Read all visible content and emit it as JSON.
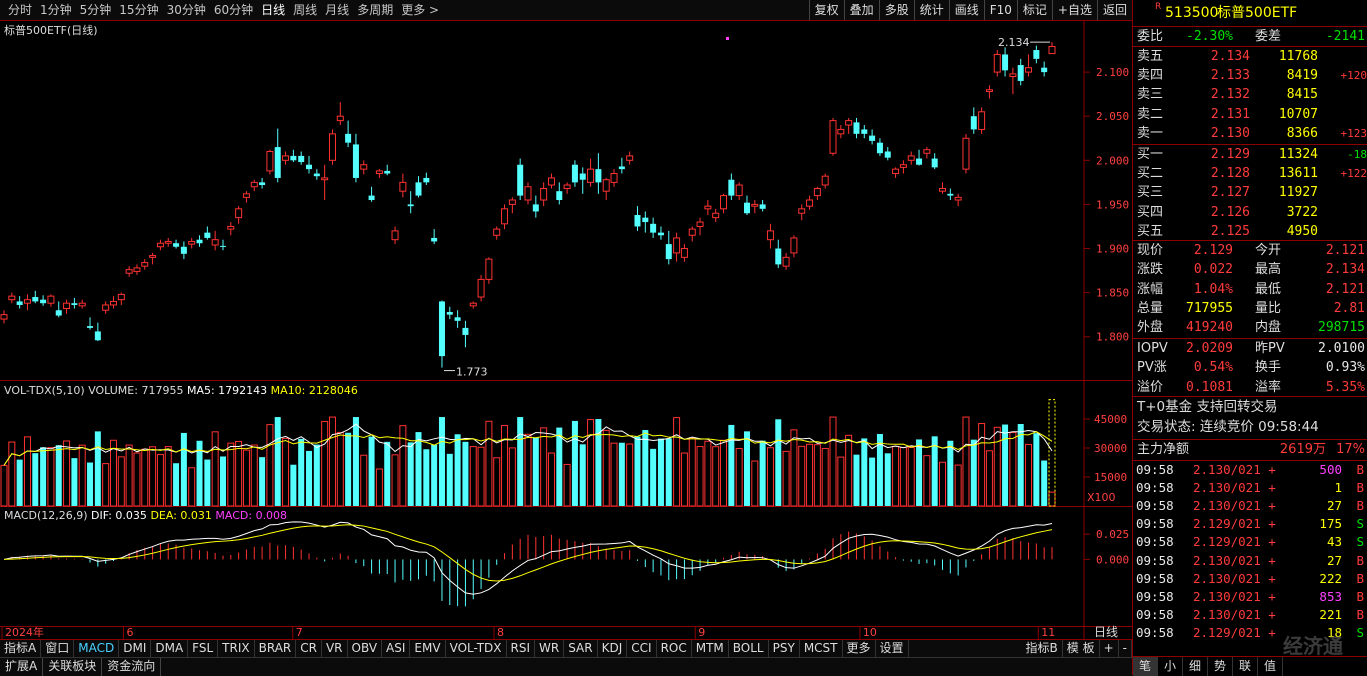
{
  "periods": [
    "分时",
    "1分钟",
    "5分钟",
    "15分钟",
    "30分钟",
    "60分钟",
    "日线",
    "周线",
    "月线",
    "多周期",
    "更多 >"
  ],
  "active_period": "日线",
  "tools": [
    "复权",
    "叠加",
    "多股",
    "统计",
    "画线",
    "F10",
    "标记",
    "+自选",
    "返回"
  ],
  "chart_title": "标普500ETF(日线)",
  "price_axis": [
    "2.100",
    "2.050",
    "2.000",
    "1.950",
    "1.900",
    "1.850",
    "1.800"
  ],
  "high_label": "2.134",
  "low_label": "1.773",
  "vol_title": {
    "name": "VOL-TDX(5,10)",
    "volume": "VOLUME: 717955",
    "ma5": "MA5: 1792143",
    "ma10": "MA10: 2128046"
  },
  "vol_axis": [
    "45000",
    "30000",
    "15000"
  ],
  "vol_unit": "X100",
  "macd_title": {
    "name": "MACD(12,26,9)",
    "dif": "DIF: 0.035",
    "dea": "DEA: 0.031",
    "macd": "MACD: 0.008"
  },
  "macd_axis": [
    "0.025",
    "0.000"
  ],
  "date_axis": [
    "2024年",
    "6",
    "7",
    "8",
    "9",
    "10",
    "11"
  ],
  "date_right": "日线",
  "indicator_tabs": [
    "指标A",
    "窗口",
    "MACD",
    "DMI",
    "DMA",
    "FSL",
    "TRIX",
    "BRAR",
    "CR",
    "VR",
    "OBV",
    "ASI",
    "EMV",
    "VOL-TDX",
    "RSI",
    "WR",
    "SAR",
    "KDJ",
    "CCI",
    "ROC",
    "MTM",
    "BOLL",
    "PSY",
    "MCST",
    "更多",
    "设置"
  ],
  "active_indicator": "MACD",
  "indicator_right": [
    "指标B",
    "模 板",
    "+",
    "-"
  ],
  "bottom_tabs": [
    "扩展A",
    "关联板块",
    "资金流向"
  ],
  "panel": {
    "marker": "R",
    "code": "513500",
    "name": "标普500ETF",
    "weibi_label": "委比",
    "weibi": "-2.30%",
    "weicha_label": "委差",
    "weicha": "-2141",
    "asks": [
      {
        "label": "卖五",
        "price": "2.134",
        "vol": "11768",
        "chg": ""
      },
      {
        "label": "卖四",
        "price": "2.133",
        "vol": "8419",
        "chg": "+120"
      },
      {
        "label": "卖三",
        "price": "2.132",
        "vol": "8415",
        "chg": ""
      },
      {
        "label": "卖二",
        "price": "2.131",
        "vol": "10707",
        "chg": ""
      },
      {
        "label": "卖一",
        "price": "2.130",
        "vol": "8366",
        "chg": "+123"
      }
    ],
    "bids": [
      {
        "label": "买一",
        "price": "2.129",
        "vol": "11324",
        "chg": "-18"
      },
      {
        "label": "买二",
        "price": "2.128",
        "vol": "13611",
        "chg": "+122"
      },
      {
        "label": "买三",
        "price": "2.127",
        "vol": "11927",
        "chg": ""
      },
      {
        "label": "买四",
        "price": "2.126",
        "vol": "3722",
        "chg": ""
      },
      {
        "label": "买五",
        "price": "2.125",
        "vol": "4950",
        "chg": ""
      }
    ],
    "quote": [
      {
        "l1": "现价",
        "v1": "2.129",
        "c1": "red",
        "l2": "今开",
        "v2": "2.121",
        "c2": "red"
      },
      {
        "l1": "涨跌",
        "v1": "0.022",
        "c1": "red",
        "l2": "最高",
        "v2": "2.134",
        "c2": "red"
      },
      {
        "l1": "涨幅",
        "v1": "1.04%",
        "c1": "red",
        "l2": "最低",
        "v2": "2.121",
        "c2": "red"
      },
      {
        "l1": "总量",
        "v1": "717955",
        "c1": "yellow",
        "l2": "量比",
        "v2": "2.81",
        "c2": "red"
      },
      {
        "l1": "外盘",
        "v1": "419240",
        "c1": "red",
        "l2": "内盘",
        "v2": "298715",
        "c2": "green"
      }
    ],
    "iopv": [
      {
        "l1": "IOPV",
        "v1": "2.0209",
        "c1": "red",
        "l2": "昨PV",
        "v2": "2.0100",
        "c2": "white"
      },
      {
        "l1": "PV涨",
        "v1": "0.54%",
        "c1": "red",
        "l2": "换手",
        "v2": "0.93%",
        "c2": "white"
      },
      {
        "l1": "溢价",
        "v1": "0.1081",
        "c1": "red",
        "l2": "溢率",
        "v2": "5.35%",
        "c2": "red"
      }
    ],
    "t0": "T+0基金 支持回转交易",
    "trade_status": "交易状态: 连续竞价 09:58:44",
    "mainflow_label": "主力净额",
    "mainflow": "2619万",
    "mainflow_pct": "17%",
    "ticks": [
      {
        "t": "09:58",
        "p": "2.130/021 +",
        "v": "500",
        "vc": "mag",
        "s": "B"
      },
      {
        "t": "09:58",
        "p": "2.130/021 +",
        "v": "1",
        "vc": "yellow",
        "s": "B"
      },
      {
        "t": "09:58",
        "p": "2.130/021 +",
        "v": "27",
        "vc": "yellow",
        "s": "B"
      },
      {
        "t": "09:58",
        "p": "2.129/021 +",
        "v": "175",
        "vc": "yellow",
        "s": "S"
      },
      {
        "t": "09:58",
        "p": "2.129/021 +",
        "v": "43",
        "vc": "yellow",
        "s": "S"
      },
      {
        "t": "09:58",
        "p": "2.130/021 +",
        "v": "27",
        "vc": "yellow",
        "s": "B"
      },
      {
        "t": "09:58",
        "p": "2.130/021 +",
        "v": "222",
        "vc": "yellow",
        "s": "B"
      },
      {
        "t": "09:58",
        "p": "2.130/021 +",
        "v": "853",
        "vc": "mag",
        "s": "B"
      },
      {
        "t": "09:58",
        "p": "2.130/021 +",
        "v": "221",
        "vc": "yellow",
        "s": "B"
      },
      {
        "t": "09:58",
        "p": "2.129/021 +",
        "v": "18",
        "vc": "yellow",
        "s": "S"
      }
    ],
    "bottom_tabs": [
      "笔",
      "小",
      "细",
      "势",
      "联",
      "值"
    ]
  },
  "watermark": "经济通",
  "chart_data": {
    "type": "candlestick",
    "y_range": [
      1.76,
      2.15
    ],
    "candles": [
      [
        1.82,
        1.83,
        1.815,
        1.825
      ],
      [
        1.842,
        1.85,
        1.838,
        1.846
      ],
      [
        1.84,
        1.846,
        1.832,
        1.836
      ],
      [
        1.838,
        1.848,
        1.83,
        1.842
      ],
      [
        1.845,
        1.852,
        1.838,
        1.84
      ],
      [
        1.842,
        1.847,
        1.835,
        1.838
      ],
      [
        1.838,
        1.848,
        1.834,
        1.846
      ],
      [
        1.83,
        1.84,
        1.822,
        1.824
      ],
      [
        1.832,
        1.842,
        1.826,
        1.838
      ],
      [
        1.838,
        1.844,
        1.832,
        1.836
      ],
      [
        1.835,
        1.842,
        1.832,
        1.838
      ],
      [
        1.812,
        1.822,
        1.808,
        1.81
      ],
      [
        1.806,
        1.816,
        1.795,
        1.796
      ],
      [
        1.83,
        1.84,
        1.826,
        1.836
      ],
      [
        1.836,
        1.846,
        1.832,
        1.84
      ],
      [
        1.842,
        1.85,
        1.836,
        1.848
      ],
      [
        1.872,
        1.88,
        1.868,
        1.876
      ],
      [
        1.874,
        1.882,
        1.87,
        1.878
      ],
      [
        1.88,
        1.888,
        1.876,
        1.884
      ],
      [
        1.89,
        1.895,
        1.882,
        1.892
      ],
      [
        1.902,
        1.91,
        1.898,
        1.906
      ],
      [
        1.906,
        1.912,
        1.902,
        1.908
      ],
      [
        1.906,
        1.91,
        1.9,
        1.902
      ],
      [
        1.902,
        1.908,
        1.888,
        1.894
      ],
      [
        1.905,
        1.912,
        1.9,
        1.908
      ],
      [
        1.91,
        1.915,
        1.902,
        1.906
      ],
      [
        1.918,
        1.925,
        1.91,
        1.912
      ],
      [
        1.904,
        1.92,
        1.898,
        1.91
      ],
      [
        1.903,
        1.91,
        1.898,
        1.902
      ],
      [
        1.922,
        1.93,
        1.915,
        1.925
      ],
      [
        1.935,
        1.948,
        1.928,
        1.945
      ],
      [
        1.958,
        1.965,
        1.952,
        1.962
      ],
      [
        1.97,
        1.978,
        1.965,
        1.975
      ],
      [
        1.975,
        1.98,
        1.968,
        1.972
      ],
      [
        1.988,
        2.012,
        1.984,
        2.01
      ],
      [
        2.015,
        2.036,
        1.975,
        1.98
      ],
      [
        2.0,
        2.01,
        1.995,
        2.005
      ],
      [
        2.005,
        2.012,
        1.998,
        2.0
      ],
      [
        2.005,
        2.01,
        1.995,
        1.998
      ],
      [
        1.995,
        2.005,
        1.985,
        1.99
      ],
      [
        1.985,
        1.99,
        1.978,
        1.982
      ],
      [
        1.978,
        1.995,
        1.955,
        1.98
      ],
      [
        2.0,
        2.035,
        1.995,
        2.03
      ],
      [
        2.045,
        2.066,
        2.04,
        2.05
      ],
      [
        2.03,
        2.045,
        2.015,
        2.02
      ],
      [
        2.018,
        2.03,
        1.975,
        1.98
      ],
      [
        1.99,
        2.0,
        1.984,
        1.995
      ],
      [
        1.96,
        1.97,
        1.953,
        1.955
      ],
      [
        1.985,
        1.99,
        1.98,
        1.988
      ],
      [
        1.988,
        1.995,
        1.983,
        1.985
      ],
      [
        1.91,
        1.925,
        1.905,
        1.92
      ],
      [
        1.965,
        1.985,
        1.958,
        1.975
      ],
      [
        1.95,
        1.965,
        1.94,
        1.948
      ],
      [
        1.975,
        1.982,
        1.958,
        1.96
      ],
      [
        1.98,
        1.986,
        1.972,
        1.975
      ],
      [
        1.912,
        1.922,
        1.905,
        1.908
      ],
      [
        1.84,
        1.841,
        1.765,
        1.778
      ],
      [
        1.828,
        1.834,
        1.82,
        1.825
      ],
      [
        1.822,
        1.83,
        1.81,
        1.818
      ],
      [
        1.81,
        1.818,
        1.788,
        1.802
      ],
      [
        1.835,
        1.84,
        1.832,
        1.838
      ],
      [
        1.845,
        1.87,
        1.84,
        1.865
      ],
      [
        1.865,
        1.89,
        1.86,
        1.888
      ],
      [
        1.915,
        1.925,
        1.91,
        1.922
      ],
      [
        1.928,
        1.95,
        1.922,
        1.945
      ],
      [
        1.95,
        1.958,
        1.94,
        1.955
      ],
      [
        1.995,
        2.002,
        1.955,
        1.96
      ],
      [
        1.955,
        1.975,
        1.95,
        1.97
      ],
      [
        1.95,
        1.96,
        1.935,
        1.942
      ],
      [
        1.955,
        1.975,
        1.948,
        1.968
      ],
      [
        1.972,
        1.985,
        1.968,
        1.98
      ],
      [
        1.965,
        1.975,
        1.95,
        1.955
      ],
      [
        1.968,
        1.975,
        1.962,
        1.972
      ],
      [
        1.995,
        2.0,
        1.97,
        1.975
      ],
      [
        1.985,
        1.992,
        1.962,
        1.978
      ],
      [
        1.975,
        2.002,
        1.97,
        1.99
      ],
      [
        1.99,
        2.008,
        1.962,
        1.975
      ],
      [
        1.965,
        1.98,
        1.955,
        1.978
      ],
      [
        1.975,
        1.99,
        1.97,
        1.985
      ],
      [
        1.993,
        2.003,
        1.985,
        1.99
      ],
      [
        2.0,
        2.01,
        1.995,
        2.005
      ],
      [
        1.938,
        1.948,
        1.92,
        1.925
      ],
      [
        1.935,
        1.942,
        1.918,
        1.93
      ],
      [
        1.928,
        1.935,
        1.912,
        1.918
      ],
      [
        1.918,
        1.925,
        1.91,
        1.915
      ],
      [
        1.905,
        1.92,
        1.882,
        1.888
      ],
      [
        1.895,
        1.918,
        1.885,
        1.912
      ],
      [
        1.89,
        1.905,
        1.885,
        1.9
      ],
      [
        1.915,
        1.925,
        1.908,
        1.922
      ],
      [
        1.925,
        1.935,
        1.915,
        1.93
      ],
      [
        1.945,
        1.955,
        1.938,
        1.948
      ],
      [
        1.935,
        1.945,
        1.93,
        1.94
      ],
      [
        1.945,
        1.962,
        1.94,
        1.96
      ],
      [
        1.978,
        1.985,
        1.955,
        1.96
      ],
      [
        1.96,
        1.975,
        1.955,
        1.972
      ],
      [
        1.952,
        1.96,
        1.938,
        1.94
      ],
      [
        1.948,
        1.955,
        1.94,
        1.95
      ],
      [
        1.95,
        1.955,
        1.942,
        1.945
      ],
      [
        1.91,
        1.928,
        1.9,
        1.92
      ],
      [
        1.9,
        1.91,
        1.878,
        1.882
      ],
      [
        1.88,
        1.895,
        1.876,
        1.89
      ],
      [
        1.895,
        1.915,
        1.89,
        1.912
      ],
      [
        1.94,
        1.95,
        1.932,
        1.945
      ],
      [
        1.948,
        1.96,
        1.944,
        1.955
      ],
      [
        1.96,
        1.97,
        1.955,
        1.968
      ],
      [
        1.972,
        1.985,
        1.968,
        1.982
      ],
      [
        2.008,
        2.048,
        2.005,
        2.045
      ],
      [
        2.03,
        2.04,
        2.025,
        2.035
      ],
      [
        2.04,
        2.048,
        2.03,
        2.045
      ],
      [
        2.043,
        2.048,
        2.025,
        2.03
      ],
      [
        2.035,
        2.04,
        2.025,
        2.03
      ],
      [
        2.028,
        2.035,
        2.018,
        2.022
      ],
      [
        2.02,
        2.025,
        2.005,
        2.008
      ],
      [
        2.01,
        2.015,
        2.0,
        2.003
      ],
      [
        1.985,
        1.992,
        1.98,
        1.99
      ],
      [
        1.992,
        2.0,
        1.985,
        1.995
      ],
      [
        2.0,
        2.01,
        1.995,
        2.005
      ],
      [
        2.002,
        2.012,
        1.994,
        1.995
      ],
      [
        2.008,
        2.015,
        2.002,
        2.012
      ],
      [
        2.002,
        2.008,
        1.99,
        1.992
      ],
      [
        1.965,
        1.975,
        1.962,
        1.968
      ],
      [
        1.962,
        1.968,
        1.955,
        1.96
      ],
      [
        1.955,
        1.962,
        1.948,
        1.958
      ],
      [
        1.99,
        2.03,
        1.985,
        2.025
      ],
      [
        2.05,
        2.06,
        2.03,
        2.035
      ],
      [
        2.035,
        2.06,
        2.03,
        2.055
      ],
      [
        2.078,
        2.085,
        2.07,
        2.08
      ],
      [
        2.1,
        2.125,
        2.095,
        2.12
      ],
      [
        2.12,
        2.128,
        2.095,
        2.102
      ],
      [
        2.095,
        2.105,
        2.075,
        2.098
      ],
      [
        2.108,
        2.115,
        2.085,
        2.09
      ],
      [
        2.1,
        2.12,
        2.095,
        2.105
      ],
      [
        2.125,
        2.13,
        2.11,
        2.115
      ],
      [
        2.105,
        2.112,
        2.095,
        2.1
      ],
      [
        2.121,
        2.134,
        2.121,
        2.129
      ]
    ],
    "volume_max": 60000,
    "macd_range": [
      -0.06,
      0.045
    ]
  }
}
